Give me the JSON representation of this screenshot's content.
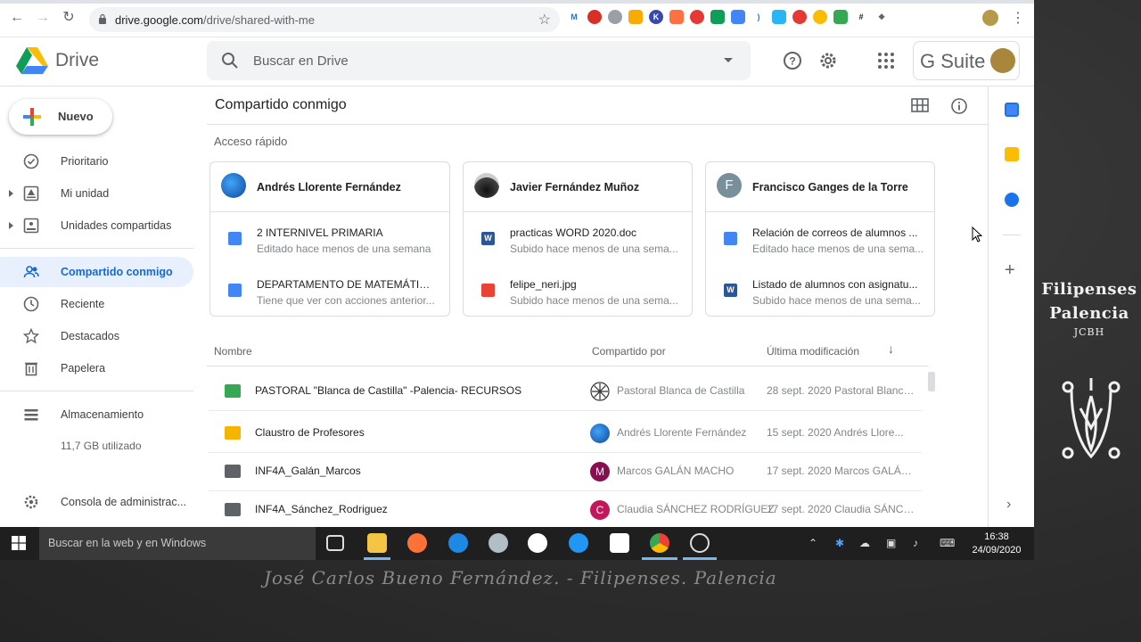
{
  "browser": {
    "url_host": "drive.google.com",
    "url_path": "/drive/shared-with-me"
  },
  "app": {
    "name": "Drive",
    "search_placeholder": "Buscar en Drive",
    "gsuite_label": "G Suite"
  },
  "sidebar": {
    "new_label": "Nuevo",
    "items": [
      {
        "label": "Prioritario",
        "icon": "check-box-icon"
      },
      {
        "label": "Mi unidad",
        "icon": "my-drive-icon"
      },
      {
        "label": "Unidades compartidas",
        "icon": "shared-drives-icon"
      },
      {
        "label": "Compartido conmigo",
        "icon": "people-icon"
      },
      {
        "label": "Reciente",
        "icon": "clock-icon"
      },
      {
        "label": "Destacados",
        "icon": "star-icon"
      },
      {
        "label": "Papelera",
        "icon": "trash-icon"
      },
      {
        "label": "Almacenamiento",
        "icon": "storage-icon"
      },
      {
        "label": "Consola de administrac...",
        "icon": "admin-gear-icon"
      }
    ],
    "storage_used": "11,7 GB utilizado"
  },
  "main": {
    "title": "Compartido conmigo",
    "quick_access_label": "Acceso rápido",
    "cards": [
      {
        "owner": "Andrés Llorente Fernández",
        "files": [
          {
            "name": "2 INTERNIVEL PRIMARIA",
            "sub": "Editado hace menos de una semana",
            "type": "doc"
          },
          {
            "name": "DEPARTAMENTO DE MATEMÁTICAS",
            "sub": "Tiene que ver con acciones anterior...",
            "type": "doc"
          }
        ]
      },
      {
        "owner": "Javier Fernández Muñoz",
        "files": [
          {
            "name": "practicas WORD 2020.doc",
            "sub": "Subido hace menos de una sema...",
            "type": "word"
          },
          {
            "name": "felipe_neri.jpg",
            "sub": "Subido hace menos de una sema...",
            "type": "image"
          }
        ]
      },
      {
        "owner": "Francisco Ganges de la Torre",
        "owner_initial": "F",
        "files": [
          {
            "name": "Relación de correos de alumnos ...",
            "sub": "Editado hace menos de una sema...",
            "type": "doc"
          },
          {
            "name": "Listado de alumnos con asignatu...",
            "sub": "Subido hace menos de una sema...",
            "type": "word"
          }
        ]
      }
    ],
    "columns": {
      "name": "Nombre",
      "shared_by": "Compartido por",
      "modified": "Última modificación"
    },
    "rows": [
      {
        "name": "PASTORAL \"Blanca de Castilla\" -Palencia- RECURSOS",
        "owner": "Pastoral Blanca de Castilla",
        "modified": "28 sept. 2020 Pastoral Blanca...",
        "type": "shared-folder-green"
      },
      {
        "name": "Claustro de Profesores",
        "owner": "Andrés Llorente Fernández",
        "modified": "15 sept. 2020 Andrés Llore...",
        "type": "shared-folder-yellow"
      },
      {
        "name": "INF4A_Galán_Marcos",
        "owner": "Marcos GALÁN MACHO",
        "owner_initial": "M",
        "modified": "17 sept. 2020 Marcos GALÁN ...",
        "type": "shared-folder-grey"
      },
      {
        "name": "INF4A_Sánchez_Rodriguez",
        "owner": "Claudia SÁNCHEZ RODRÍGUEZ",
        "owner_initial": "C",
        "modified": "17 sept. 2020 Claudia SÁNCH...",
        "type": "shared-folder-grey"
      }
    ]
  },
  "taskbar": {
    "search_text": "Buscar en la web y en Windows",
    "time": "16:38",
    "date": "24/09/2020"
  },
  "overlay": {
    "brand_line1": "Filipenses",
    "brand_line2": "Palencia",
    "brand_line3": "JCBH",
    "signature": "José Carlos Bueno Fernández. - Filipenses. Palencia"
  },
  "colors": {
    "accent_blue": "#1967d2",
    "active_bg": "#e8f0fe",
    "doc_blue": "#4285f4",
    "image_red": "#ea4335",
    "folder_green": "#34a853",
    "folder_yellow": "#f4b400"
  }
}
